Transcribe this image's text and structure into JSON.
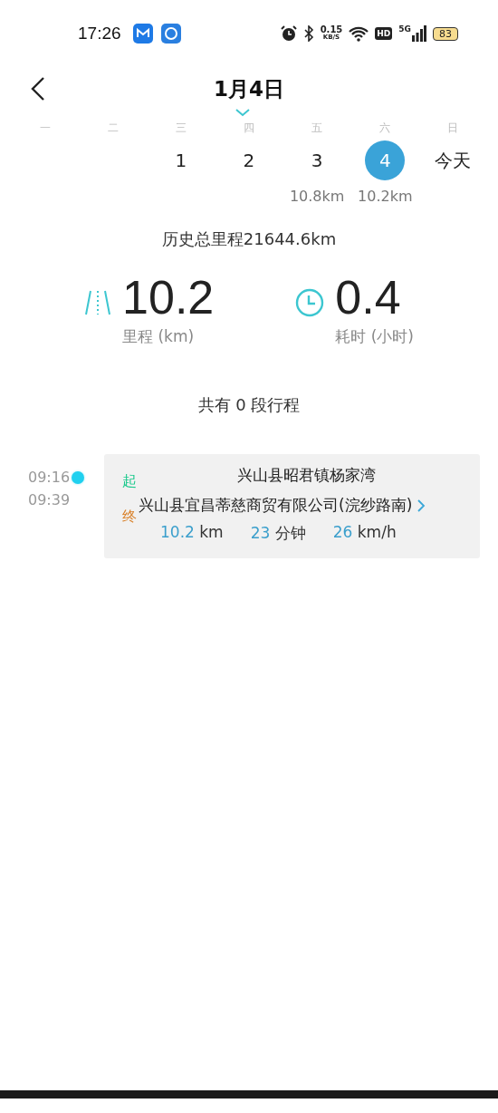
{
  "status_bar": {
    "time": "17:26",
    "net_speed": "0.15",
    "net_speed_unit": "KB/S",
    "hd": "HD",
    "network": "5G",
    "battery": "83"
  },
  "header": {
    "title": "1月4日"
  },
  "calendar": {
    "weekdays": [
      "一",
      "二",
      "三",
      "四",
      "五",
      "六",
      "日"
    ],
    "days": [
      {
        "label": "1",
        "selected": false
      },
      {
        "label": "2",
        "selected": false
      },
      {
        "label": "3",
        "distance": "10.8km",
        "selected": false
      },
      {
        "label": "4",
        "distance": "10.2km",
        "selected": true
      },
      {
        "label": "今天",
        "selected": false
      }
    ]
  },
  "total": "历史总里程21644.6km",
  "stats": [
    {
      "kind": "distance",
      "value": "10.2",
      "label": "里程 (km)"
    },
    {
      "kind": "duration",
      "value": "0.4",
      "label": "耗时 (小时)"
    }
  ],
  "trip_count": "共有 0 段行程",
  "trips": [
    {
      "start_time": "09:16",
      "end_time": "09:39",
      "start_mark": "起",
      "start": "兴山县昭君镇杨家湾",
      "end_mark": "终",
      "end": "兴山县宜昌蒂慈商贸有限公司(浣纱路南)",
      "distance": "10.2",
      "distance_unit": "km",
      "duration": "23",
      "duration_unit": "分钟",
      "speed": "26",
      "speed_unit": "km/h"
    }
  ]
}
